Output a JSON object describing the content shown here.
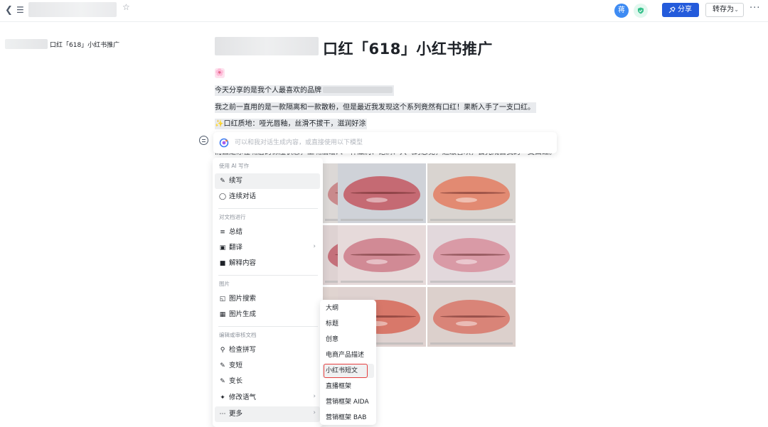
{
  "header": {
    "avatar_initial": "蒋",
    "share_label": "分享",
    "save_as_label": "转存为",
    "more_label": "···"
  },
  "outline": {
    "title": "口红「618」小红书推广"
  },
  "document": {
    "title": "口红「618」小红书推广",
    "emoji": "🌸",
    "paragraphs": [
      "今天分享的是我个人最喜欢的品牌",
      "我之前一直用的是一款隔离和一款散粉，但是最近我发现这个系列竟然有口红！果断入手了一支口红。",
      "✨口红质地：哑光唇釉，丝滑不拔干，滋润好涂",
      "而且是涂在嘴唇的保湿状态，上嘴后给人一种滋润、饱满、大气的感觉，超级喜欢，会完成自我的一支口红。"
    ]
  },
  "ai_bar": {
    "placeholder": "可以和我对话生成内容，或直接使用以下模型"
  },
  "ai_menu": {
    "groups": {
      "write": "使用 AI 写作",
      "doc": "对文档进行",
      "image": "图片",
      "edit": "编辑或审核文档"
    },
    "items": {
      "continue": "续写",
      "chat": "连续对话",
      "summary": "总结",
      "translate": "翻译",
      "explain": "解释内容",
      "image_search": "图片搜索",
      "image_gen": "图片生成",
      "spellcheck": "检查拼写",
      "shorten": "变短",
      "lengthen": "变长",
      "tone": "修改语气",
      "more": "更多"
    }
  },
  "sub_menu": {
    "items": [
      "大纲",
      "标题",
      "创意",
      "电商产品描述",
      "小红书短文",
      "直播框架",
      "营销框架 AIDA",
      "营销框架 BAB"
    ],
    "highlighted": "小红书短文"
  },
  "colors": {
    "accent": "#245bdb",
    "highlight_border": "#e53e3e",
    "avatar": "#3e8bf3"
  },
  "images": {
    "lips": [
      {
        "bg": "#dcd8d6",
        "lip": "#c98a8c"
      },
      {
        "bg": "#cfd2d8",
        "lip": "#c56a73"
      },
      {
        "bg": "#d9d4d0",
        "lip": "#e28a72"
      },
      {
        "bg": "#ded2d2",
        "lip": "#c4707a"
      },
      {
        "bg": "#e6dada",
        "lip": "#d18a95"
      },
      {
        "bg": "#e2d8dc",
        "lip": "#d99aa6"
      },
      {
        "bg": "#e0d4d0",
        "lip": "#d7786e"
      },
      {
        "bg": "#dfd2d0",
        "lip": "#d8786a"
      },
      {
        "bg": "#dcd0cc",
        "lip": "#d98478"
      }
    ]
  }
}
